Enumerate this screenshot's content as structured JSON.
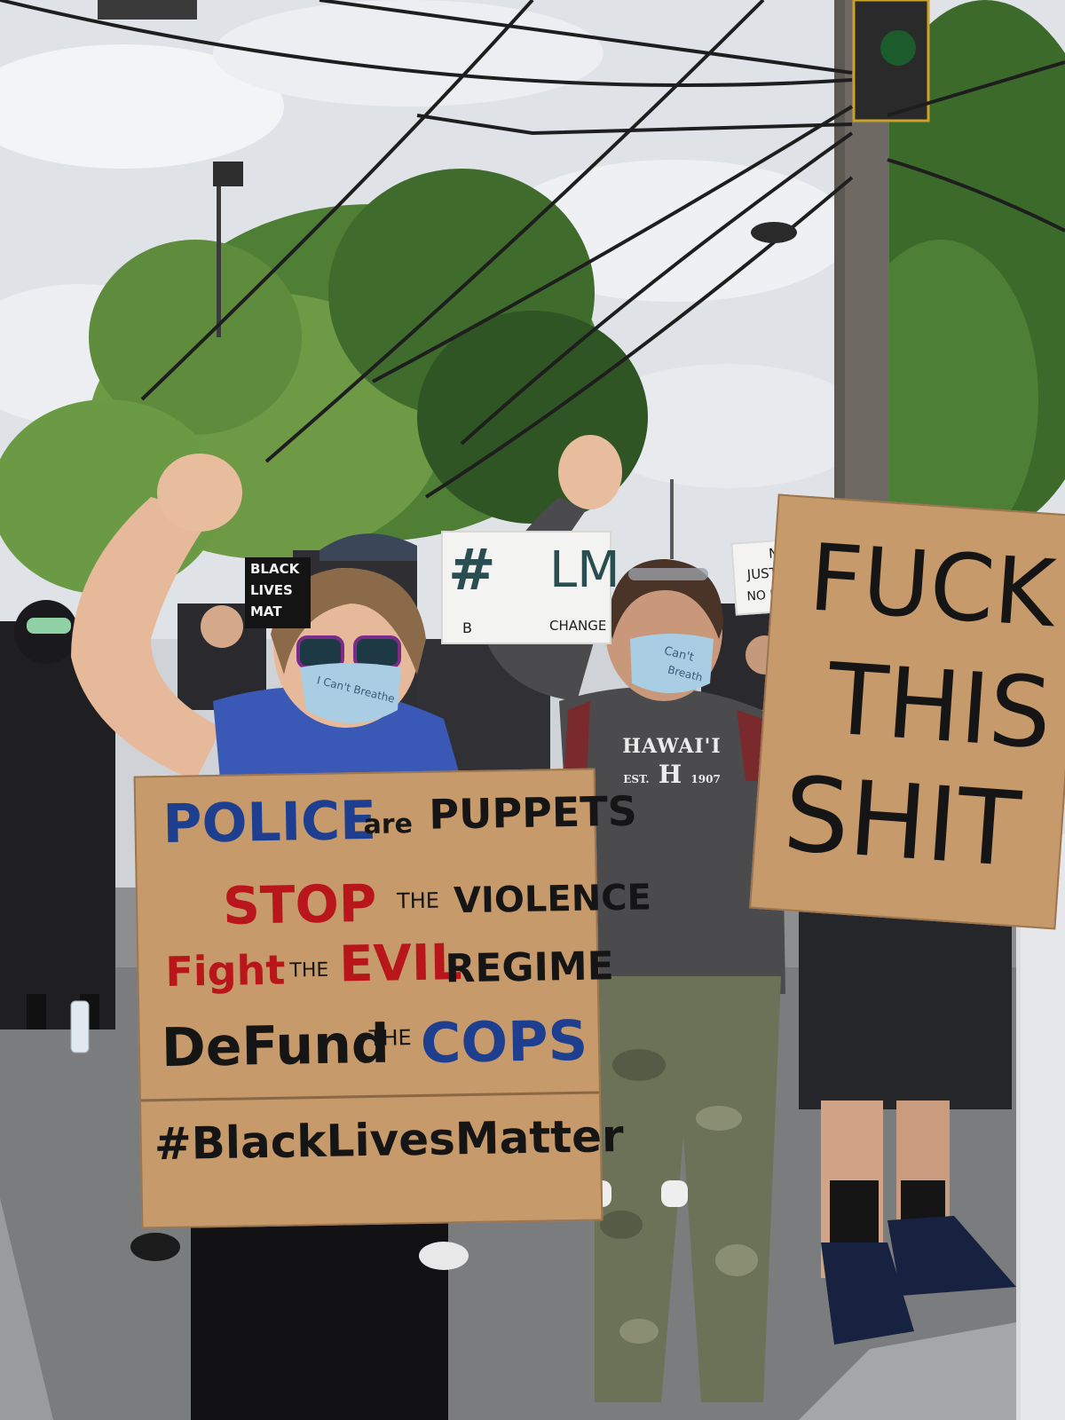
{
  "photo": {
    "colors": {
      "sky": "#dfe2e7",
      "cloud": "#f3f4f6",
      "tree_dark": "#3f6b2d",
      "tree_light": "#6e9a45",
      "road": "#7b7c7e",
      "cardboard": "#c69a6a",
      "mask": "#a9cde3",
      "shirt_blue": "#3a58b5",
      "sweatshirt": "#4b4b4e",
      "camo": "#6c7258"
    }
  },
  "signs": {
    "main": {
      "line1_a": "POLICE",
      "line1_b": "are",
      "line1_c": "PUPPETS",
      "line2_a": "STOP",
      "line2_b": "THE",
      "line2_c": "VIOLENCE",
      "line3_a": "Fight",
      "line3_b": "THE",
      "line3_c": "EVIL",
      "line3_d": "REGIME",
      "line4_a": "DeFund",
      "line4_b": "THE",
      "line4_c": "COPS",
      "hashtag": "#BlackLivesMatter"
    },
    "right": {
      "line1": "FUCK",
      "line2": "THIS",
      "line3": "SHIT"
    },
    "blm": {
      "text_a": "#",
      "text_b": "LM",
      "small_a": "B",
      "small_b": "CHANGE"
    },
    "no_justice": {
      "line1": "NO",
      "line2": "JUSTICE",
      "line3": "NO PEACE"
    },
    "black_lives": {
      "line1": "BLACK",
      "line2": "LIVES",
      "line3": "MAT"
    }
  },
  "masks": {
    "left_text": "I Can't Breathe",
    "right_text_a": "Can't",
    "right_text_b": "Breath"
  },
  "sweatshirt": {
    "word": "HAWAI'I",
    "est_a": "EST.",
    "letter": "H",
    "est_b": "1907"
  }
}
